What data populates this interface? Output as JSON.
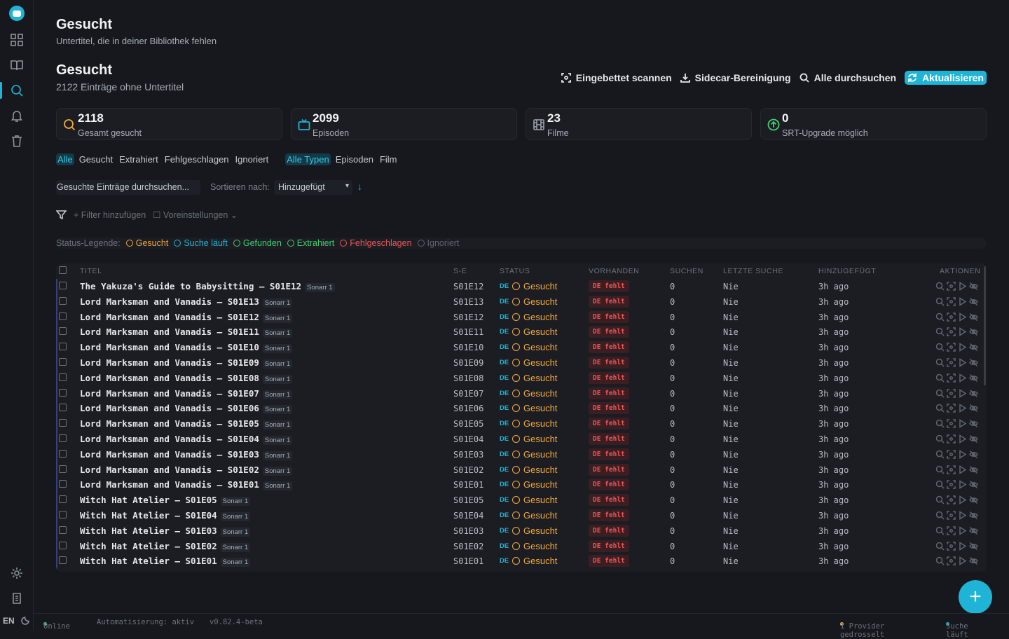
{
  "header": {
    "title": "Gesucht",
    "subtitle": "Untertitel, die in deiner Bibliothek fehlen"
  },
  "section": {
    "title": "Gesucht",
    "subtitle": "2122 Einträge ohne Untertitel"
  },
  "actions": {
    "scan_embedded": "Eingebettet scannen",
    "sidecar_cleanup": "Sidecar-Bereinigung",
    "search_all": "Alle durchsuchen",
    "refresh": "Aktualisieren"
  },
  "stats": [
    {
      "value": "2118",
      "label": "Gesamt gesucht",
      "icon": "search-icon",
      "color": "#f2a93b"
    },
    {
      "value": "2099",
      "label": "Episoden",
      "icon": "tv-icon",
      "color": "#1fb4d6"
    },
    {
      "value": "23",
      "label": "Filme",
      "icon": "film-icon",
      "color": "#8f949d"
    },
    {
      "value": "0",
      "label": "SRT-Upgrade möglich",
      "icon": "arrow-up-circle-icon",
      "color": "#3fcf6c"
    }
  ],
  "status_filters": [
    "Alle",
    "Gesucht",
    "Extrahiert",
    "Fehlgeschlagen",
    "Ignoriert"
  ],
  "type_filters": [
    "Alle Typen",
    "Episoden",
    "Film"
  ],
  "search": {
    "placeholder": "Gesuchte Einträge durchsuchen..."
  },
  "sort": {
    "label": "Sortieren nach:",
    "value": "Hinzugefügt"
  },
  "filters": {
    "add": "+ Filter hinzufügen",
    "presets": "Voreinstellungen"
  },
  "legend": {
    "title": "Status-Legende:",
    "items": [
      {
        "label": "Gesucht",
        "color": "#f2a93b"
      },
      {
        "label": "Suche läuft",
        "color": "#1fb4d6"
      },
      {
        "label": "Gefunden",
        "color": "#3fcf6c"
      },
      {
        "label": "Extrahiert",
        "color": "#3fcf6c"
      },
      {
        "label": "Fehlgeschlagen",
        "color": "#ee5656"
      },
      {
        "label": "Ignoriert",
        "color": "#5f646d"
      }
    ]
  },
  "table": {
    "columns": [
      "TITEL",
      "S-E",
      "STATUS",
      "VORHANDEN",
      "SUCHEN",
      "LETZTE SUCHE",
      "HINZUGEFÜGT",
      "AKTIONEN"
    ],
    "rows": [
      {
        "title": "The Yakuza's Guide to Babysitting – S01E12",
        "source": "Sonarr 1",
        "se": "S01E12",
        "lang": "DE",
        "status": "Gesucht",
        "avail": "DE fehlt",
        "count": "0",
        "last": "Nie",
        "added": "3h ago"
      },
      {
        "title": "Lord Marksman and Vanadis – S01E13",
        "source": "Sonarr 1",
        "se": "S01E13",
        "lang": "DE",
        "status": "Gesucht",
        "avail": "DE fehlt",
        "count": "0",
        "last": "Nie",
        "added": "3h ago"
      },
      {
        "title": "Lord Marksman and Vanadis – S01E12",
        "source": "Sonarr 1",
        "se": "S01E12",
        "lang": "DE",
        "status": "Gesucht",
        "avail": "DE fehlt",
        "count": "0",
        "last": "Nie",
        "added": "3h ago"
      },
      {
        "title": "Lord Marksman and Vanadis – S01E11",
        "source": "Sonarr 1",
        "se": "S01E11",
        "lang": "DE",
        "status": "Gesucht",
        "avail": "DE fehlt",
        "count": "0",
        "last": "Nie",
        "added": "3h ago"
      },
      {
        "title": "Lord Marksman and Vanadis – S01E10",
        "source": "Sonarr 1",
        "se": "S01E10",
        "lang": "DE",
        "status": "Gesucht",
        "avail": "DE fehlt",
        "count": "0",
        "last": "Nie",
        "added": "3h ago"
      },
      {
        "title": "Lord Marksman and Vanadis – S01E09",
        "source": "Sonarr 1",
        "se": "S01E09",
        "lang": "DE",
        "status": "Gesucht",
        "avail": "DE fehlt",
        "count": "0",
        "last": "Nie",
        "added": "3h ago"
      },
      {
        "title": "Lord Marksman and Vanadis – S01E08",
        "source": "Sonarr 1",
        "se": "S01E08",
        "lang": "DE",
        "status": "Gesucht",
        "avail": "DE fehlt",
        "count": "0",
        "last": "Nie",
        "added": "3h ago"
      },
      {
        "title": "Lord Marksman and Vanadis – S01E07",
        "source": "Sonarr 1",
        "se": "S01E07",
        "lang": "DE",
        "status": "Gesucht",
        "avail": "DE fehlt",
        "count": "0",
        "last": "Nie",
        "added": "3h ago"
      },
      {
        "title": "Lord Marksman and Vanadis – S01E06",
        "source": "Sonarr 1",
        "se": "S01E06",
        "lang": "DE",
        "status": "Gesucht",
        "avail": "DE fehlt",
        "count": "0",
        "last": "Nie",
        "added": "3h ago"
      },
      {
        "title": "Lord Marksman and Vanadis – S01E05",
        "source": "Sonarr 1",
        "se": "S01E05",
        "lang": "DE",
        "status": "Gesucht",
        "avail": "DE fehlt",
        "count": "0",
        "last": "Nie",
        "added": "3h ago"
      },
      {
        "title": "Lord Marksman and Vanadis – S01E04",
        "source": "Sonarr 1",
        "se": "S01E04",
        "lang": "DE",
        "status": "Gesucht",
        "avail": "DE fehlt",
        "count": "0",
        "last": "Nie",
        "added": "3h ago"
      },
      {
        "title": "Lord Marksman and Vanadis – S01E03",
        "source": "Sonarr 1",
        "se": "S01E03",
        "lang": "DE",
        "status": "Gesucht",
        "avail": "DE fehlt",
        "count": "0",
        "last": "Nie",
        "added": "3h ago"
      },
      {
        "title": "Lord Marksman and Vanadis – S01E02",
        "source": "Sonarr 1",
        "se": "S01E02",
        "lang": "DE",
        "status": "Gesucht",
        "avail": "DE fehlt",
        "count": "0",
        "last": "Nie",
        "added": "3h ago"
      },
      {
        "title": "Lord Marksman and Vanadis – S01E01",
        "source": "Sonarr 1",
        "se": "S01E01",
        "lang": "DE",
        "status": "Gesucht",
        "avail": "DE fehlt",
        "count": "0",
        "last": "Nie",
        "added": "3h ago"
      },
      {
        "title": "Witch Hat Atelier – S01E05",
        "source": "Sonarr 1",
        "se": "S01E05",
        "lang": "DE",
        "status": "Gesucht",
        "avail": "DE fehlt",
        "count": "0",
        "last": "Nie",
        "added": "3h ago"
      },
      {
        "title": "Witch Hat Atelier – S01E04",
        "source": "Sonarr 1",
        "se": "S01E04",
        "lang": "DE",
        "status": "Gesucht",
        "avail": "DE fehlt",
        "count": "0",
        "last": "Nie",
        "added": "3h ago"
      },
      {
        "title": "Witch Hat Atelier – S01E03",
        "source": "Sonarr 1",
        "se": "S01E03",
        "lang": "DE",
        "status": "Gesucht",
        "avail": "DE fehlt",
        "count": "0",
        "last": "Nie",
        "added": "3h ago"
      },
      {
        "title": "Witch Hat Atelier – S01E02",
        "source": "Sonarr 1",
        "se": "S01E02",
        "lang": "DE",
        "status": "Gesucht",
        "avail": "DE fehlt",
        "count": "0",
        "last": "Nie",
        "added": "3h ago"
      },
      {
        "title": "Witch Hat Atelier – S01E01",
        "source": "Sonarr 1",
        "se": "S01E01",
        "lang": "DE",
        "status": "Gesucht",
        "avail": "DE fehlt",
        "count": "0",
        "last": "Nie",
        "added": "3h ago"
      }
    ]
  },
  "footer": {
    "online": "Online",
    "automation": "Automatisierung: aktiv",
    "version": "v0.82.4-beta",
    "throttled": "1 Provider gedrosselt",
    "searching": "Suche läuft"
  },
  "sidebar": {
    "language": "EN"
  }
}
